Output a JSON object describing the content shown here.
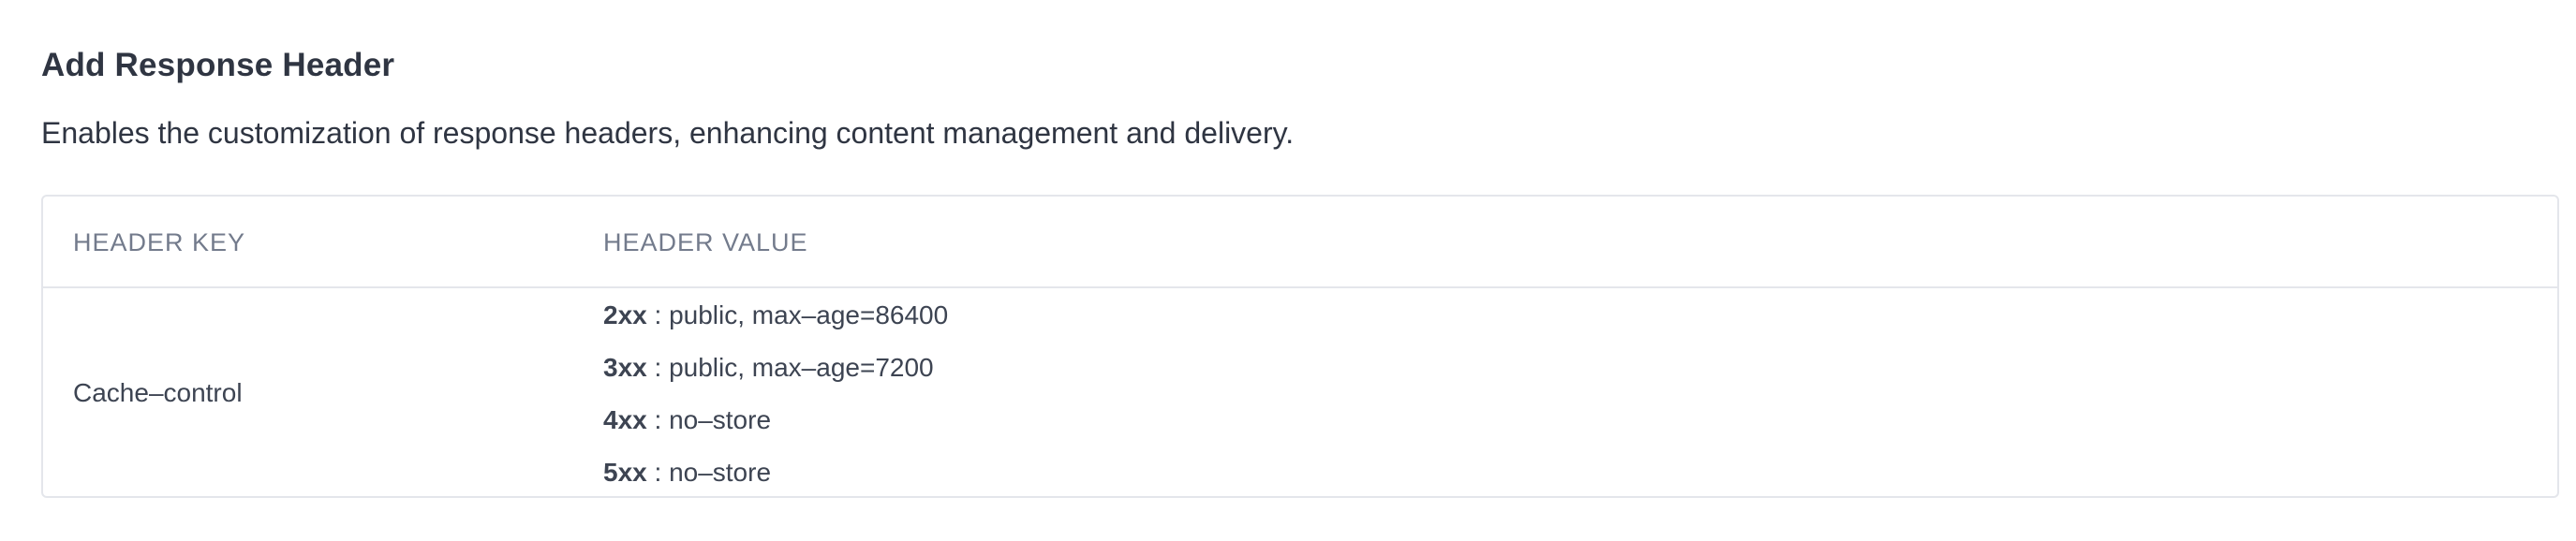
{
  "section": {
    "title": "Add Response Header",
    "description": "Enables the customization of response headers, enhancing content management and delivery."
  },
  "table": {
    "columns": [
      "HEADER KEY",
      "HEADER VALUE"
    ],
    "rows": [
      {
        "key": "Cache–control",
        "values": [
          {
            "code": "2xx",
            "separator": " : ",
            "value": "public, max–age=86400"
          },
          {
            "code": "3xx",
            "separator": " : ",
            "value": "public, max–age=7200"
          },
          {
            "code": "4xx",
            "separator": " : ",
            "value": "no–store"
          },
          {
            "code": "5xx",
            "separator": " : ",
            "value": "no–store"
          }
        ]
      }
    ]
  }
}
